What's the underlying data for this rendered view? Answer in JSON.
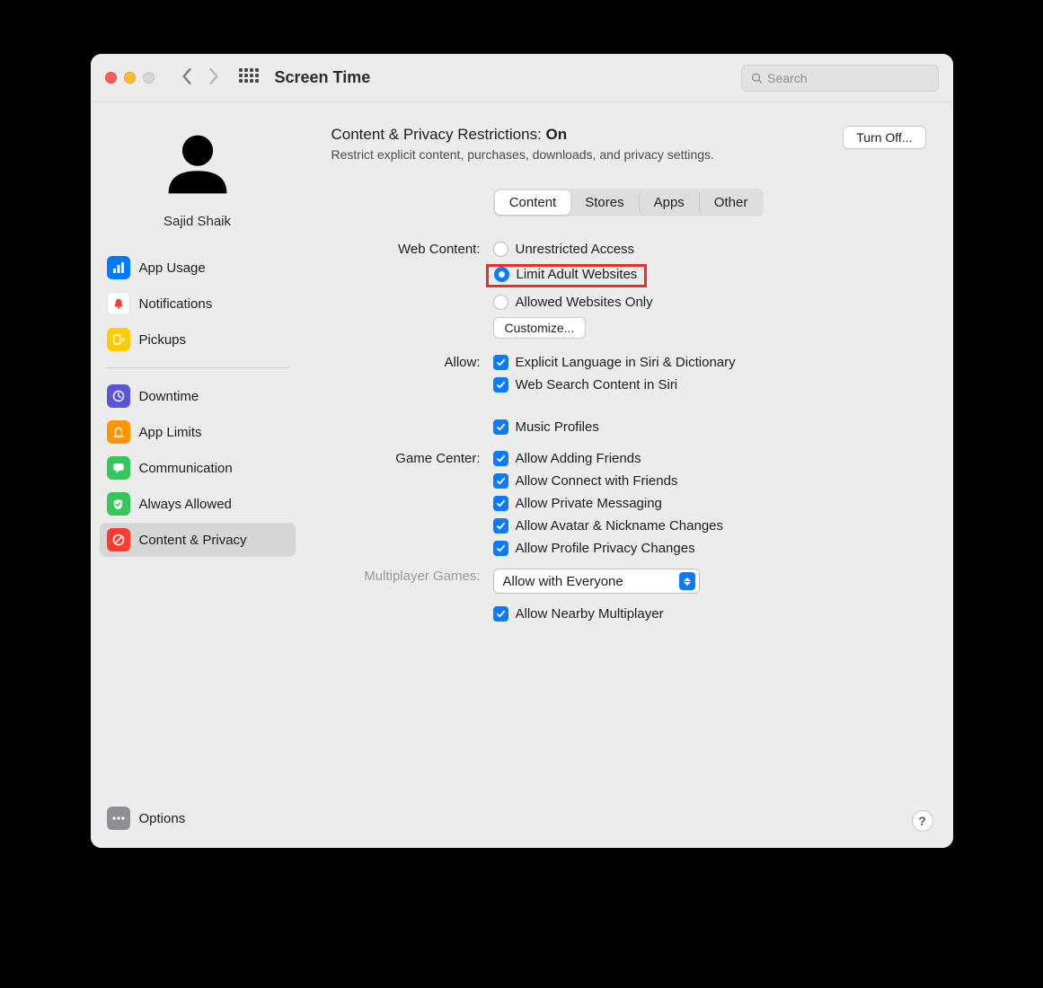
{
  "toolbar": {
    "title": "Screen Time",
    "search_placeholder": "Search"
  },
  "user": {
    "name": "Sajid Shaik"
  },
  "sidebar": {
    "items": [
      {
        "label": "App Usage"
      },
      {
        "label": "Notifications"
      },
      {
        "label": "Pickups"
      },
      {
        "label": "Downtime"
      },
      {
        "label": "App Limits"
      },
      {
        "label": "Communication"
      },
      {
        "label": "Always Allowed"
      },
      {
        "label": "Content & Privacy"
      },
      {
        "label": "Options"
      }
    ]
  },
  "header": {
    "title_prefix": "Content & Privacy Restrictions: ",
    "title_value": "On",
    "subtitle": "Restrict explicit content, purchases, downloads, and privacy settings.",
    "turn_off_label": "Turn Off..."
  },
  "tabs": {
    "items": [
      "Content",
      "Stores",
      "Apps",
      "Other"
    ],
    "active_index": 0
  },
  "sections": {
    "web_content": {
      "label": "Web Content:",
      "options": [
        "Unrestricted Access",
        "Limit Adult Websites",
        "Allowed Websites Only"
      ],
      "selected_index": 1,
      "customize_label": "Customize..."
    },
    "allow": {
      "label": "Allow:",
      "items": [
        {
          "label": "Explicit Language in Siri & Dictionary",
          "checked": true
        },
        {
          "label": "Web Search Content in Siri",
          "checked": true
        },
        {
          "label": "Music Profiles",
          "checked": true
        }
      ]
    },
    "game_center": {
      "label": "Game Center:",
      "items": [
        {
          "label": "Allow Adding Friends",
          "checked": true
        },
        {
          "label": "Allow Connect with Friends",
          "checked": true
        },
        {
          "label": "Allow Private Messaging",
          "checked": true
        },
        {
          "label": "Allow Avatar & Nickname Changes",
          "checked": true
        },
        {
          "label": "Allow Profile Privacy Changes",
          "checked": true
        }
      ]
    },
    "multiplayer": {
      "label": "Multiplayer Games:",
      "select_value": "Allow with Everyone",
      "nearby": {
        "label": "Allow Nearby Multiplayer",
        "checked": true
      }
    }
  },
  "help_label": "?"
}
